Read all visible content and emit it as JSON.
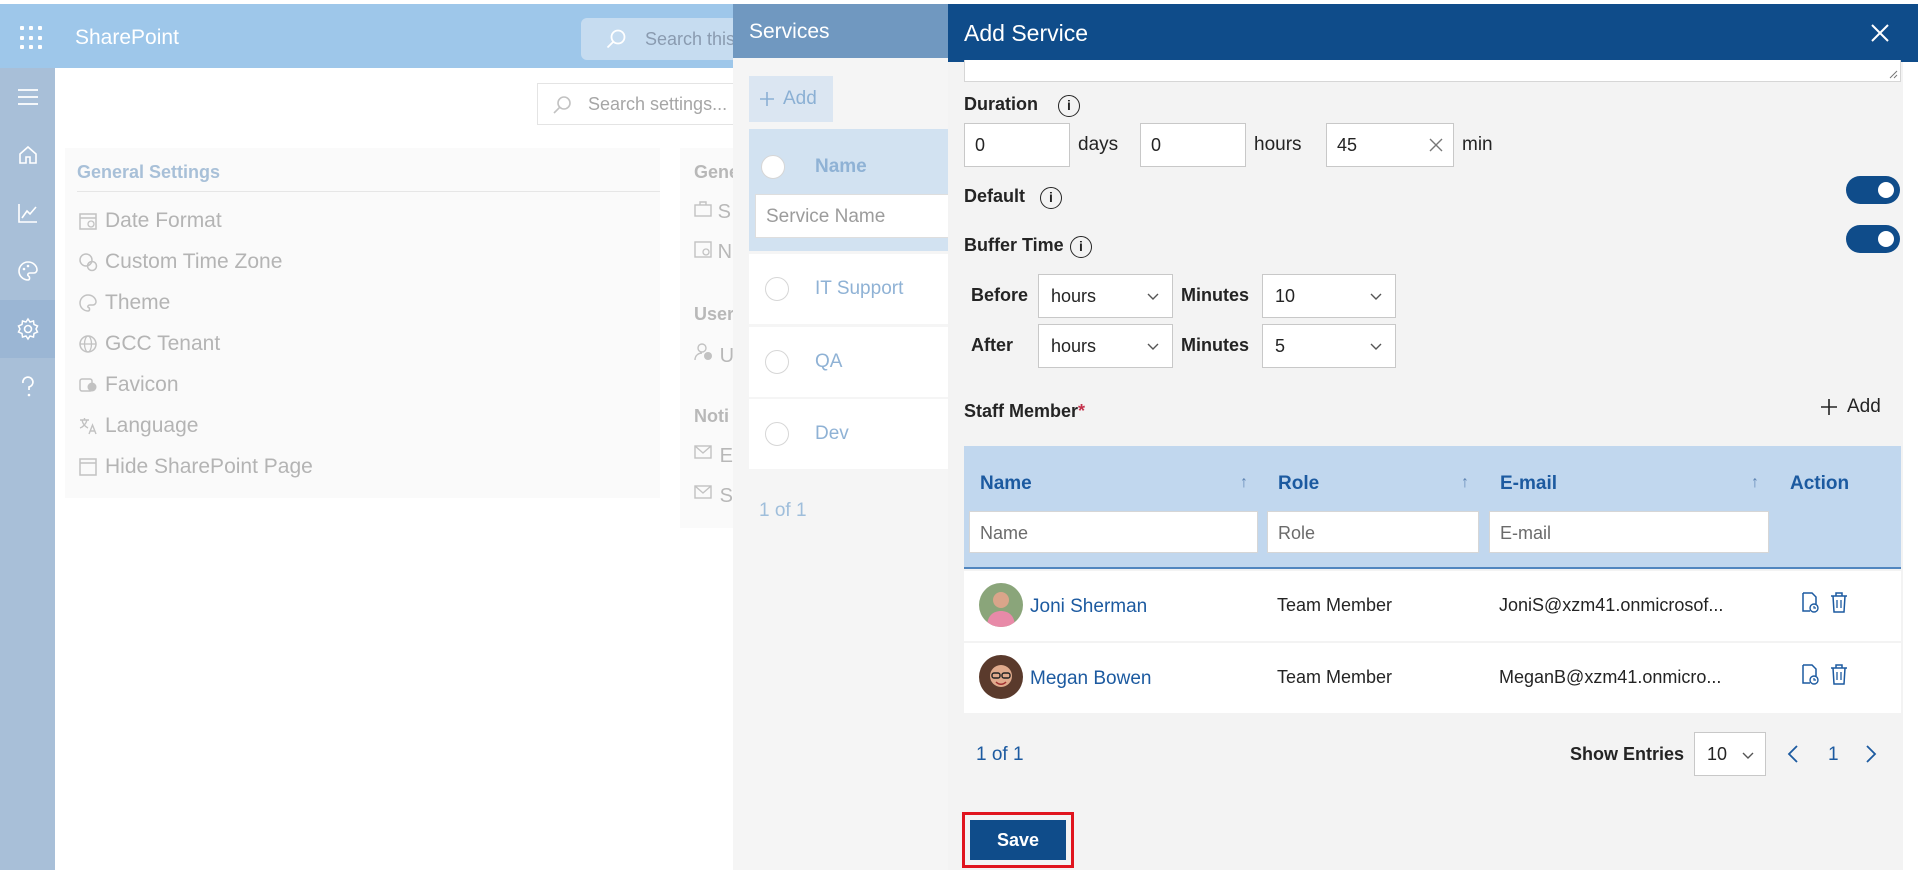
{
  "app": {
    "brand": "SharePoint",
    "top_search_placeholder": "Search this",
    "settings_search_placeholder": "Search settings..."
  },
  "rail": {
    "icons": [
      "menu-icon",
      "home-icon",
      "analytics-icon",
      "palette-icon",
      "settings-icon",
      "help-icon"
    ],
    "active": "settings-icon"
  },
  "general_settings": {
    "title": "General Settings",
    "items": [
      {
        "label": "Date Format",
        "icon": "calendar-icon"
      },
      {
        "label": "Custom Time Zone",
        "icon": "time-zone-icon"
      },
      {
        "label": "Theme",
        "icon": "palette-icon"
      },
      {
        "label": "GCC Tenant",
        "icon": "globe-icon"
      },
      {
        "label": "Favicon",
        "icon": "favicon-icon"
      },
      {
        "label": "Language",
        "icon": "language-icon"
      },
      {
        "label": "Hide SharePoint Page",
        "icon": "page-icon"
      }
    ]
  },
  "partial_column": {
    "headers": [
      "Gene",
      "User",
      "Noti"
    ],
    "letters": [
      "S",
      "N",
      "U",
      "E",
      "S"
    ]
  },
  "services": {
    "title": "Services",
    "add_label": "Add",
    "column_name": "Name",
    "filter_placeholder": "Service Name",
    "rows": [
      "IT Support",
      "QA",
      "Dev"
    ],
    "pagination": "1 of 1"
  },
  "add_service": {
    "title": "Add Service",
    "duration": {
      "label": "Duration",
      "days_value": "0",
      "days_unit": "days",
      "hours_value": "0",
      "hours_unit": "hours",
      "min_value": "45",
      "min_unit": "min"
    },
    "default_label": "Default",
    "default_on": true,
    "buffer_label": "Buffer Time",
    "buffer_on": true,
    "before_label": "Before",
    "after_label": "After",
    "minutes_label": "Minutes",
    "before_unit": "hours",
    "before_minutes": "10",
    "after_unit": "hours",
    "after_minutes": "5",
    "staff": {
      "title": "Staff Member",
      "required_mark": "*",
      "add_label": "Add",
      "columns": {
        "name": "Name",
        "role": "Role",
        "email": "E-mail",
        "action": "Action"
      },
      "filters": {
        "name": "Name",
        "role": "Role",
        "email": "E-mail"
      },
      "rows": [
        {
          "name": "Joni Sherman",
          "role": "Team Member",
          "email": "JoniS@xzm41.onmicrosof..."
        },
        {
          "name": "Megan Bowen",
          "role": "Team Member",
          "email": "MeganB@xzm41.onmicro..."
        }
      ],
      "pagination": "1 of 1",
      "show_entries_label": "Show Entries",
      "show_entries_value": "10",
      "current_page": "1"
    },
    "save_label": "Save"
  },
  "colors": {
    "primary": "#0f4c8a",
    "link": "#1c5aa0",
    "table_header": "#c1d7ee",
    "highlight_border": "#e0141e"
  }
}
